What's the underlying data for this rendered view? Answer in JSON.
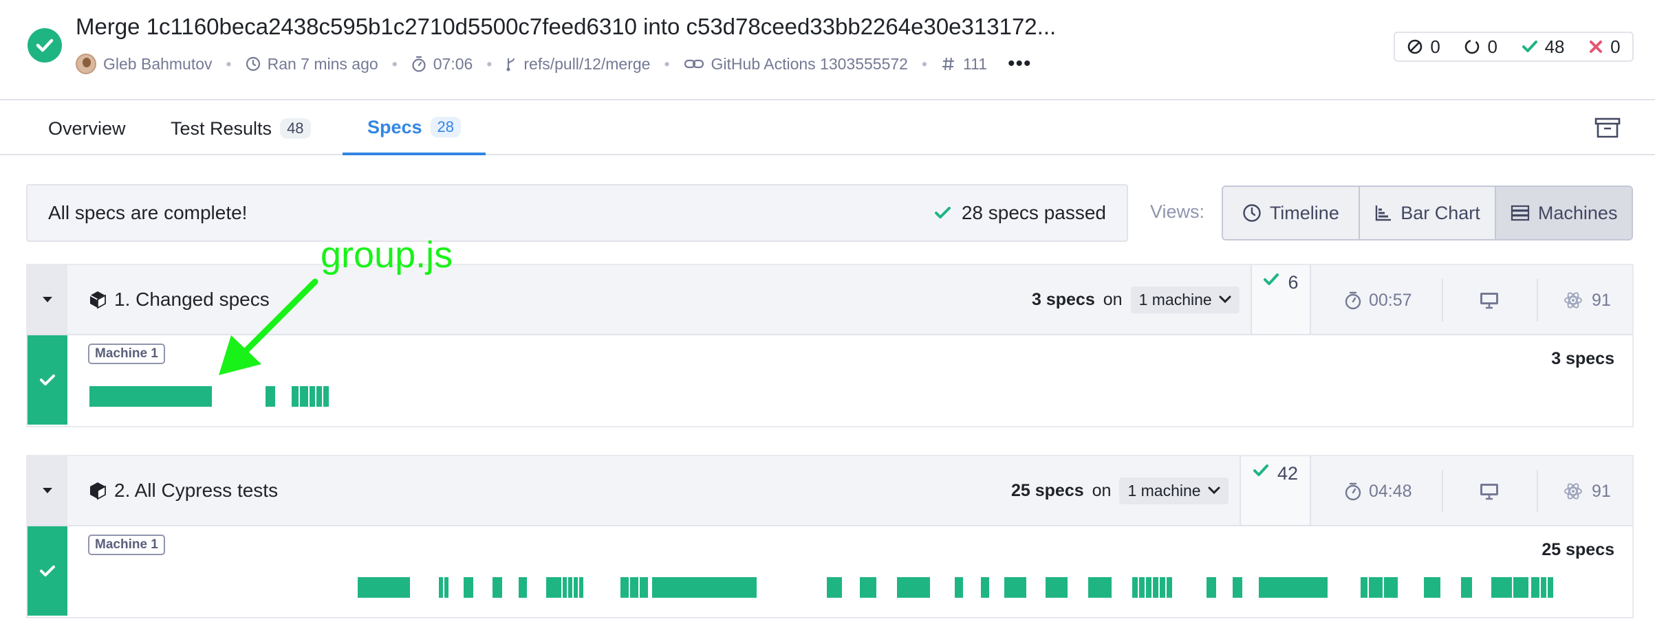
{
  "run": {
    "title": "Merge 1c1160beca2438c595b1c2710d5500c7feed6310 into c53d78ceed33bb2264e30e313172...",
    "author": "Gleb Bahmutov",
    "ran": "Ran 7 mins ago",
    "duration": "07:06",
    "branch": "refs/pull/12/merge",
    "ci": "GitHub Actions 1303555572",
    "run_number": "111",
    "more": "•••"
  },
  "counts": {
    "skipped": "0",
    "pending": "0",
    "passed": "48",
    "failed": "0"
  },
  "tabs": [
    {
      "label": "Overview",
      "badge": ""
    },
    {
      "label": "Test Results",
      "badge": "48"
    },
    {
      "label": "Specs",
      "badge": "28"
    }
  ],
  "banner": {
    "message": "All specs are complete!",
    "status": "28 specs passed"
  },
  "views": {
    "label": "Views:",
    "options": [
      "Timeline",
      "Bar Chart",
      "Machines"
    ]
  },
  "groups": [
    {
      "name": "1. Changed specs",
      "specs_count": "3 specs",
      "on": "on",
      "machines": "1 machine",
      "passed": "6",
      "duration": "00:57",
      "browser_version": "91",
      "machine_label": "Machine 1",
      "machine_specs": "3 specs"
    },
    {
      "name": "2. All Cypress tests",
      "specs_count": "25 specs",
      "on": "on",
      "machines": "1 machine",
      "passed": "42",
      "duration": "04:48",
      "browser_version": "91",
      "machine_label": "Machine 1",
      "machine_specs": "25 specs"
    }
  ],
  "annotation": {
    "text": "group.js",
    "color": "#18f218"
  },
  "colors": {
    "pass": "#1fb582",
    "fail": "#e45770",
    "accent": "#3486e3"
  }
}
